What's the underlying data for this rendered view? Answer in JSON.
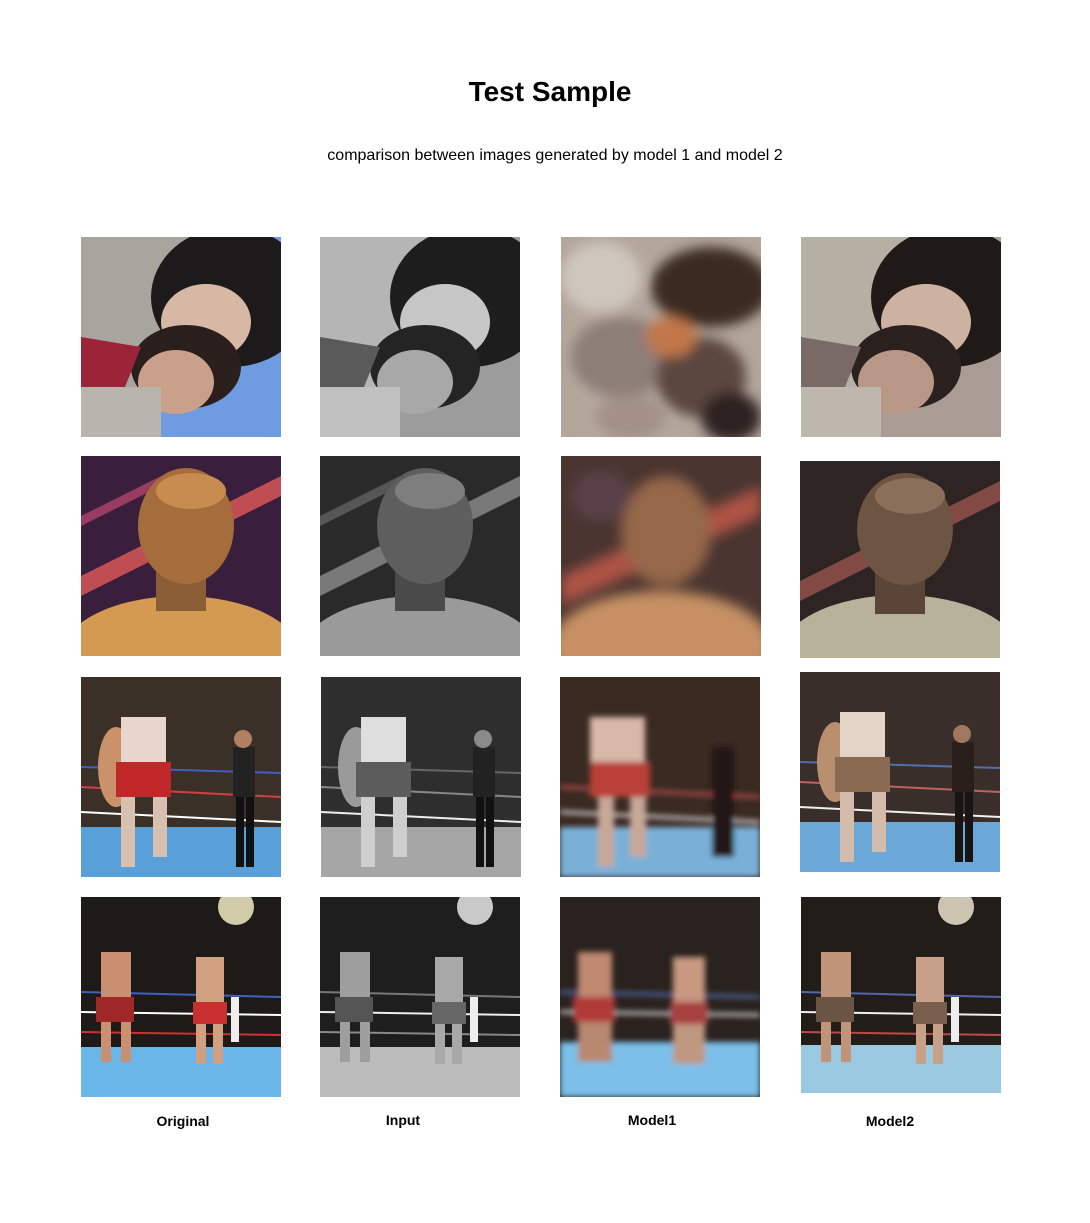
{
  "title": "Test Sample",
  "subtitle": "comparison between images generated by model 1 and model 2",
  "columns": [
    "Original",
    "Input",
    "Model1",
    "Model2"
  ],
  "rows": [
    {
      "subject": "couple-selfie-photo"
    },
    {
      "subject": "boxer-portrait-photo"
    },
    {
      "subject": "kickboxing-fight-photo"
    },
    {
      "subject": "kickboxing-faceoff-photo"
    }
  ]
}
